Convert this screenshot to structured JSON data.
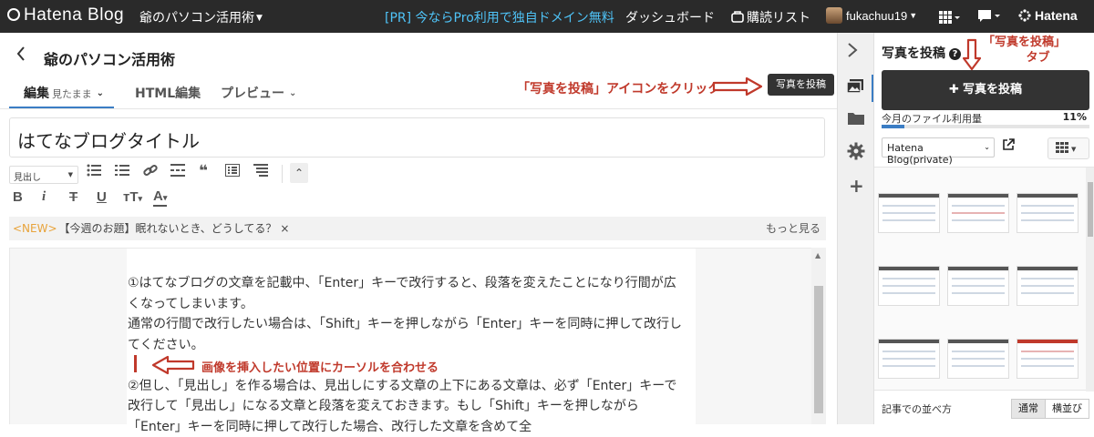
{
  "topbar": {
    "logo": "Hatena Blog",
    "blog_name": "爺のパソコン活用術",
    "promo": "[PR] 今ならPro利用で独自ドメイン無料",
    "dashboard": "ダッシュボード",
    "reader": "購読リスト",
    "user": "fukachuu19",
    "hatena": "Hatena"
  },
  "editor": {
    "blog_title": "爺のパソコン活用術",
    "tabs": {
      "edit": "編集",
      "edit_mode": "見たまま",
      "html": "HTML編集",
      "preview": "プレビュー"
    },
    "title_value": "はてなブログタイトル",
    "heading_select": "見出し",
    "notice": {
      "new_badge": "<NEW>",
      "text": "【今週のお題】眠れないとき、どうしてる？",
      "close": "×",
      "more": "もっと見る"
    },
    "paragraphs": [
      "①はてなブログの文章を記載中、「Enter」キーで改行すると、段落を変えたことになり行間が広くなってしまいます。",
      "通常の行間で改行したい場合は、「Shift」キーを押しながら「Enter」キーを同時に押して改行してください。",
      "②但し、「見出し」を作る場合は、見出しにする文章の上下にある文章は、必ず「Enter」キーで改行して「見出し」になる文章と段落を変えておきます。もし「Shift」キーを押しながら「Enter」キーを同時に押して改行した場合、改行した文章を含めて全"
    ]
  },
  "annotations": {
    "click_icon": "「写真を投稿」アイコンをクリック",
    "cursor_hint": "画像を挿入したい位置にカーソルを合わせる",
    "tab_hint_1": "「写真を投稿」",
    "tab_hint_2": "タブ"
  },
  "tooltip": "写真を投稿",
  "panel": {
    "title": "写真を投稿",
    "help": "?",
    "upload_button": "写真を投稿",
    "usage_label": "今月のファイル利用量",
    "usage_percent_text": "11%",
    "usage_percent": 11,
    "folder": "Hatena Blog(private)",
    "sort_label": "記事での並べ方",
    "sort_normal": "通常",
    "sort_side": "横並び"
  },
  "colors": {
    "topbar": "#2a2a2a",
    "accent": "#3b7dc4",
    "annotation": "#c0392b",
    "promo": "#4fc3f7"
  }
}
